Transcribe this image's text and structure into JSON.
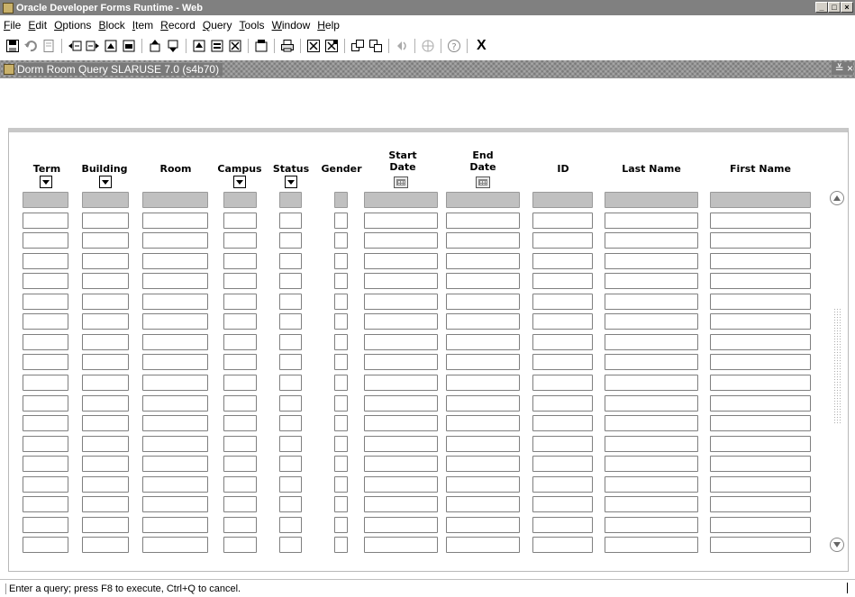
{
  "window": {
    "title": "Oracle Developer Forms Runtime - Web",
    "min_btn": "_",
    "max_btn": "□",
    "close_btn": "×"
  },
  "menu": [
    {
      "prefix": "",
      "u": "F",
      "rest": "ile"
    },
    {
      "prefix": "",
      "u": "E",
      "rest": "dit"
    },
    {
      "prefix": "",
      "u": "O",
      "rest": "ptions"
    },
    {
      "prefix": "",
      "u": "B",
      "rest": "lock"
    },
    {
      "prefix": "",
      "u": "I",
      "rest": "tem"
    },
    {
      "prefix": "",
      "u": "R",
      "rest": "ecord"
    },
    {
      "prefix": "",
      "u": "Q",
      "rest": "uery"
    },
    {
      "prefix": "",
      "u": "T",
      "rest": "ools"
    },
    {
      "prefix": "",
      "u": "W",
      "rest": "indow"
    },
    {
      "prefix": "",
      "u": "H",
      "rest": "elp"
    }
  ],
  "toolbar": {
    "exit_label": "X"
  },
  "document": {
    "title": "Dorm Room Query  SLARUSE  7.0  (s4b70)",
    "controls": "≚ ×"
  },
  "columns": {
    "term": "Term",
    "building": "Building",
    "room": "Room",
    "campus": "Campus",
    "status": "Status",
    "gender": "Gender",
    "start_date_1": "Start",
    "start_date_2": "Date",
    "end_date_1": "End",
    "end_date_2": "Date",
    "id": "ID",
    "last_name": "Last Name",
    "first_name": "First Name"
  },
  "grid": {
    "row_count": 18
  },
  "status_bar": {
    "message": "Enter a query;  press F8 to execute, Ctrl+Q to cancel."
  }
}
